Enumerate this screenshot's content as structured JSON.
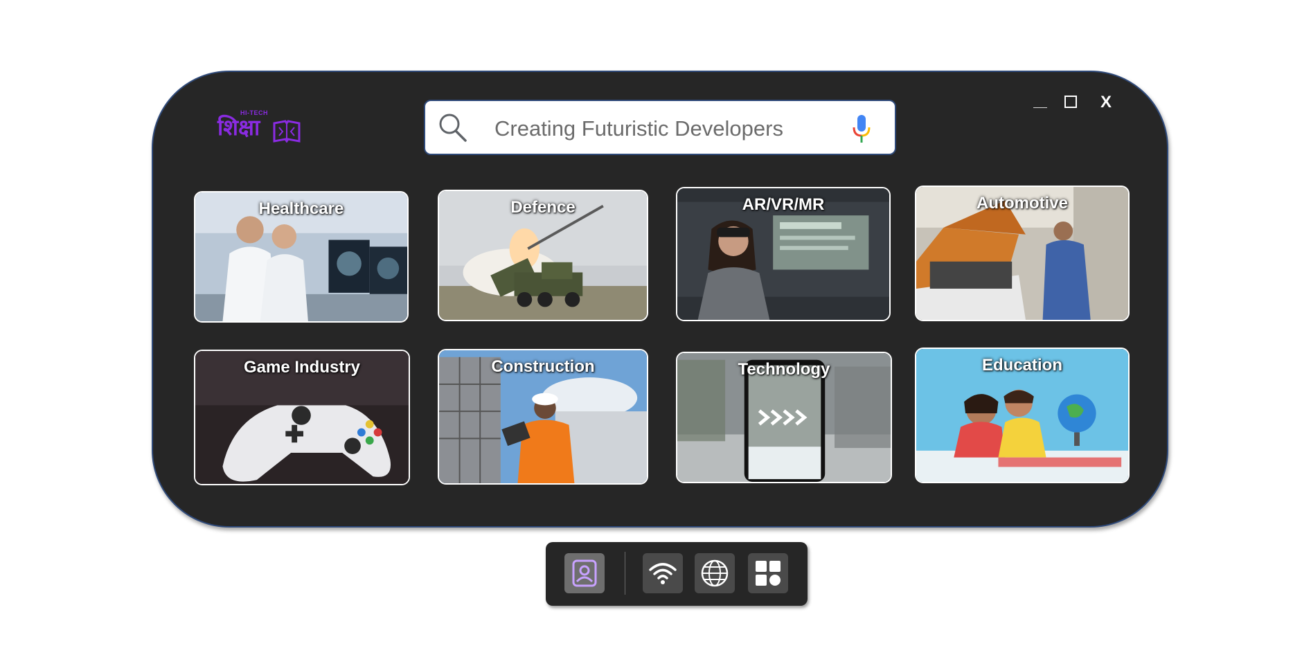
{
  "app": {
    "logo": {
      "top_text": "HI-TECH",
      "main_text": "शिक्षा",
      "color": "#8a2be2"
    },
    "window_controls": {
      "minimize_icon": "minimize-icon",
      "maximize_icon": "maximize-icon",
      "close_label": "X"
    }
  },
  "search": {
    "text": "Creating Futuristic Developers",
    "search_icon": "magnifier-icon",
    "mic_icon": "microphone-icon"
  },
  "categories": [
    {
      "label": "Healthcare"
    },
    {
      "label": "Defence"
    },
    {
      "label": "AR/VR/MR"
    },
    {
      "label": "Automotive"
    },
    {
      "label": "Game Industry"
    },
    {
      "label": "Construction"
    },
    {
      "label": "Technology"
    },
    {
      "label": "Education"
    }
  ],
  "dock": {
    "items": [
      {
        "icon": "user-profile-icon",
        "active": true
      },
      {
        "icon": "wifi-icon",
        "active": false
      },
      {
        "icon": "globe-icon",
        "active": false
      },
      {
        "icon": "apps-grid-icon",
        "active": false
      }
    ]
  },
  "colors": {
    "window_bg": "#262626",
    "window_border": "#2f4a7a",
    "accent_purple": "#8a2be2"
  }
}
